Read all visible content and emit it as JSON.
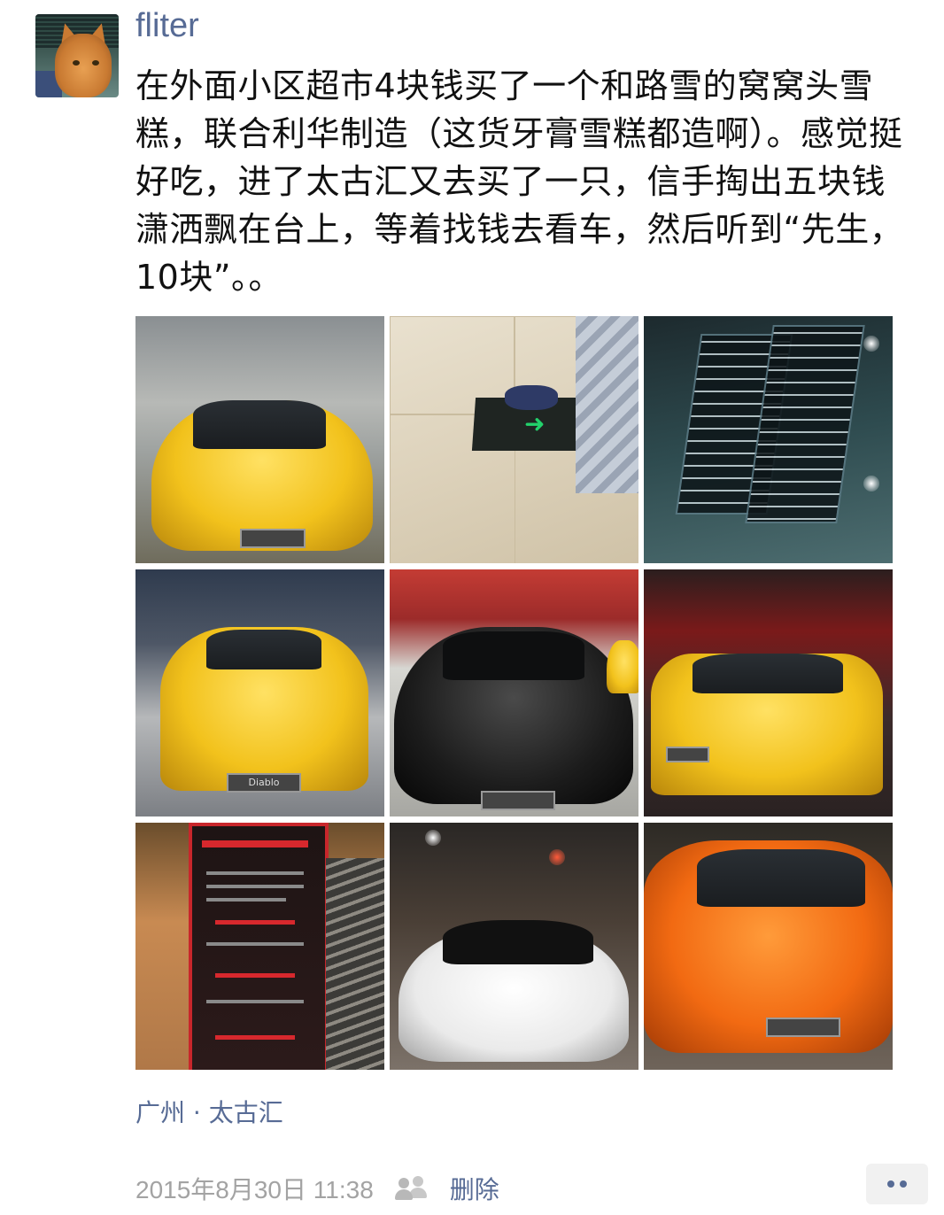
{
  "post": {
    "username": "fliter",
    "text": "在外面小区超市4块钱买了一个和路雪的窝窝头雪糕，联合利华制造（这货牙膏雪糕都造啊）。感觉挺好吃，进了太古汇又去买了一只，信手掏出五块钱潇洒飘在台上，等着找钱去看车，然后听到“先生，10块”。。",
    "location": "广州 · 太古汇",
    "timestamp": "2015年8月30日 11:38",
    "delete_label": "删除"
  },
  "photos": [
    {
      "subject": "yellow Lamborghini Huracan"
    },
    {
      "subject": "slippers on tiled floor with green arrow sign"
    },
    {
      "subject": "menu board reflection"
    },
    {
      "subject": "yellow Lamborghini Diablo",
      "plate": "Diablo"
    },
    {
      "subject": "black Lamborghini Aventador"
    },
    {
      "subject": "yellow Lamborghini Countach"
    },
    {
      "subject": "red exhibition sign stand"
    },
    {
      "subject": "white Lamborghini Aventador roadster"
    },
    {
      "subject": "orange Lamborghini Aventador"
    }
  ],
  "icons": {
    "visibility": "friends-icon",
    "more": "more-icon"
  },
  "colors": {
    "link": "#576b95",
    "text": "#111111",
    "meta": "#a3a3a3"
  }
}
